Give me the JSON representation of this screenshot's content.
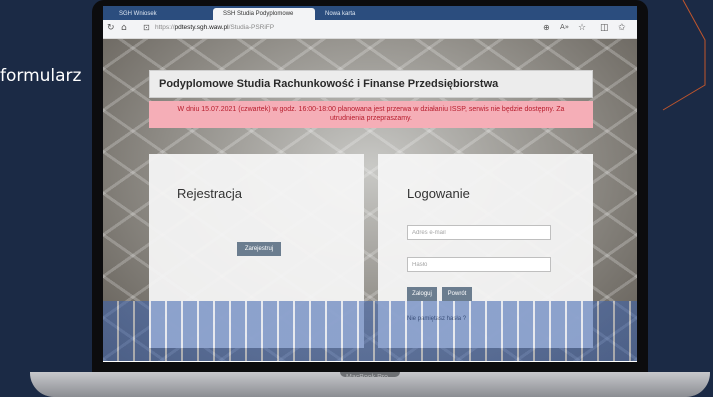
{
  "slide": {
    "left_text": "formularz"
  },
  "browser": {
    "tabs": [
      {
        "label": "SGH Wniosek"
      },
      {
        "label": "SSH Studia Podyplomowe"
      },
      {
        "label": "Nowa karta"
      }
    ],
    "url_prefix": "https://",
    "url_host": "pdtesty.sgh.waw.pl",
    "url_path": "/Studia-PSRiFP",
    "icons": [
      "back-icon",
      "home-icon",
      "lock-icon",
      "zoom-icon",
      "read-aloud-icon",
      "favorite-icon",
      "collections-icon",
      "extensions-icon"
    ]
  },
  "page": {
    "header_title": "Podyplomowe Studia Rachunkowość i Finanse Przedsiębiorstwa",
    "alert_text": "W dniu 15.07.2021 (czwartek) w godz. 16:00-18:00 planowana jest przerwa w działaniu ISSP, serwis nie będzie dostępny. Za utrudnienia przepraszamy.",
    "registration": {
      "title": "Rejestracja",
      "register_button": "Zarejestruj"
    },
    "login": {
      "title": "Logowanie",
      "email_placeholder": "Adres e-mail",
      "password_placeholder": "Hasło",
      "login_button": "Zaloguj",
      "back_button": "Powrót",
      "forgot_link": "Nie pamiętasz hasła ?"
    }
  },
  "device": {
    "brand": "MacBook Pro"
  },
  "colors": {
    "background": "#1b2a45",
    "alert_bg": "#f5aeb7",
    "alert_text": "#b71d2d",
    "button": "#6b7d8f",
    "accent_line": "#c0552c"
  }
}
